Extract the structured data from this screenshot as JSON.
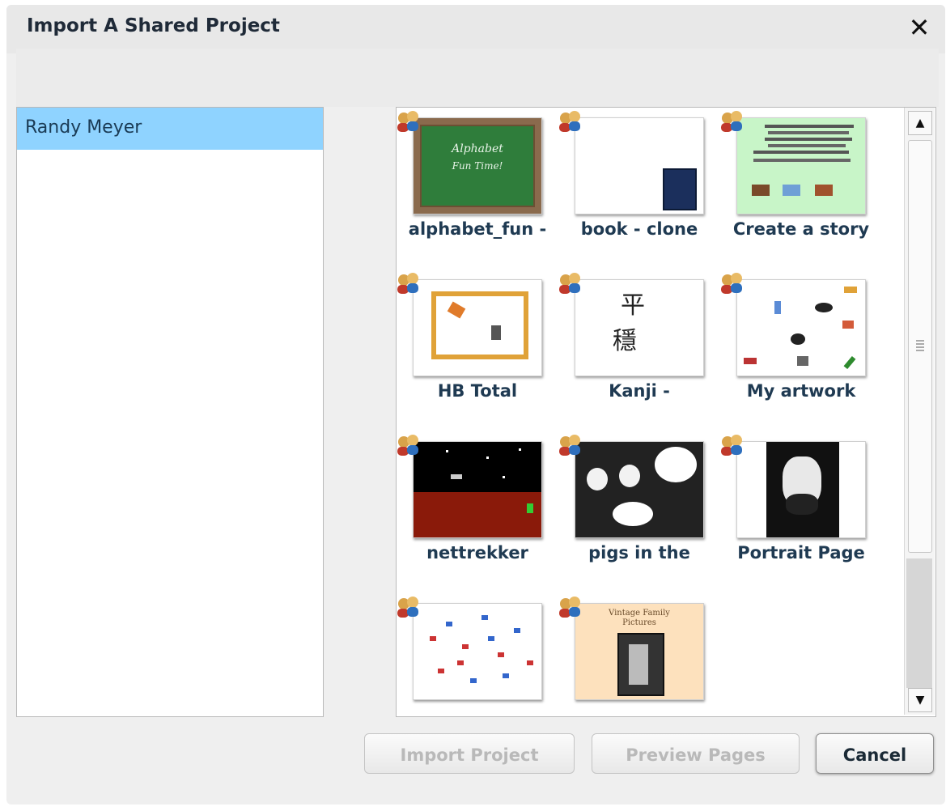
{
  "dialog": {
    "title": "Import A Shared Project",
    "close_symbol": "✕"
  },
  "users": [
    {
      "name": "Randy Meyer",
      "selected": true
    }
  ],
  "projects": [
    {
      "title": "alphabet_fun -",
      "thumb_text": [
        "Alphabet",
        "Fun Time!"
      ]
    },
    {
      "title": "book - clone"
    },
    {
      "title": "Create a story"
    },
    {
      "title": "HB Total"
    },
    {
      "title": "Kanji -",
      "thumb_text": [
        "平",
        "穩"
      ]
    },
    {
      "title": "My artwork"
    },
    {
      "title": "nettrekker"
    },
    {
      "title": "pigs in the"
    },
    {
      "title": "Portrait Page"
    },
    {
      "title": ""
    },
    {
      "title": "",
      "thumb_text": [
        "Vintage Family",
        "Pictures"
      ]
    }
  ],
  "buttons": {
    "import": "Import Project",
    "preview": "Preview Pages",
    "cancel": "Cancel"
  },
  "scrollbar": {
    "up_arrow": "▲",
    "down_arrow": "▼"
  },
  "colors": {
    "selected_row": "#8fd3ff",
    "caption_text": "#1f3a52"
  }
}
